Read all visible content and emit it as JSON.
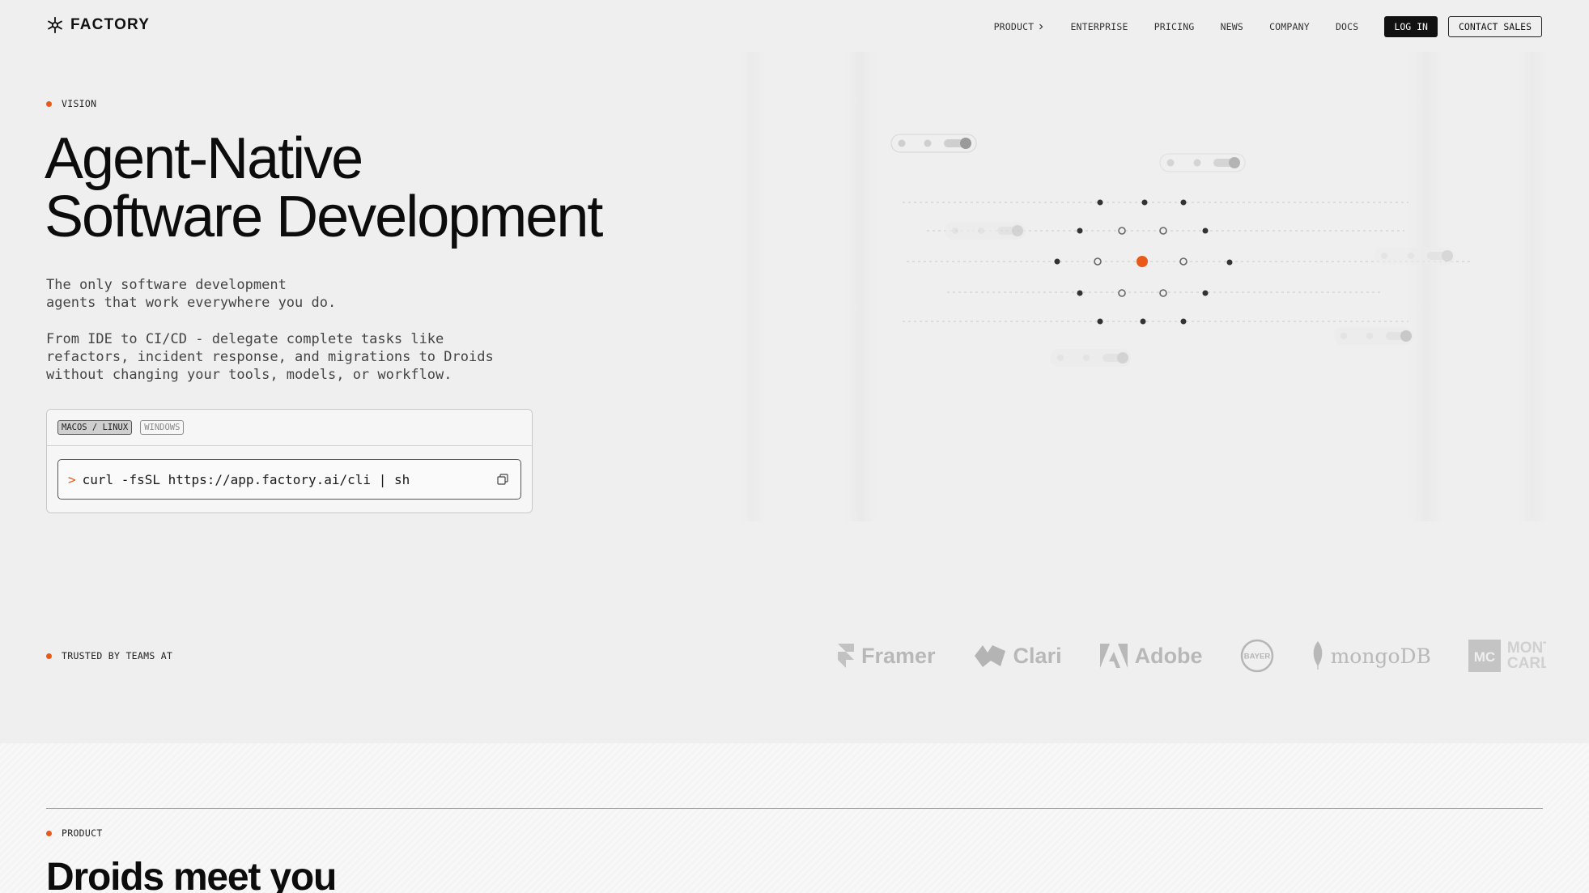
{
  "header": {
    "logo_text": "FACTORY",
    "nav": [
      {
        "label": "PRODUCT",
        "has_chevron": true
      },
      {
        "label": "ENTERPRISE"
      },
      {
        "label": "PRICING"
      },
      {
        "label": "NEWS"
      },
      {
        "label": "COMPANY"
      },
      {
        "label": "DOCS"
      }
    ],
    "login_label": "LOG IN",
    "contact_label": "CONTACT SALES"
  },
  "hero": {
    "eyebrow": "VISION",
    "title_line1": "Agent-Native",
    "title_line2": "Software Development",
    "para1": "The only software development\nagents that work everywhere you do.",
    "para2": "From IDE to CI/CD - delegate complete tasks like\nrefactors, incident response, and migrations to Droids\nwithout changing your tools, models, or workflow.",
    "install": {
      "tabs": [
        "MACOS / LINUX",
        "WINDOWS"
      ],
      "active_tab": "MACOS / LINUX",
      "prompt": ">",
      "command": "curl -fsSL https://app.factory.ai/cli | sh"
    }
  },
  "trusted": {
    "eyebrow": "TRUSTED BY TEAMS AT",
    "brands": [
      "Framer",
      "Clari",
      "Adobe",
      "BAYER",
      "mongoDB",
      "MONTE CARLO"
    ]
  },
  "product": {
    "eyebrow": "PRODUCT",
    "title": "Droids meet you"
  },
  "colors": {
    "accent": "#e8591a",
    "background": "#efefef",
    "text": "#111111"
  }
}
